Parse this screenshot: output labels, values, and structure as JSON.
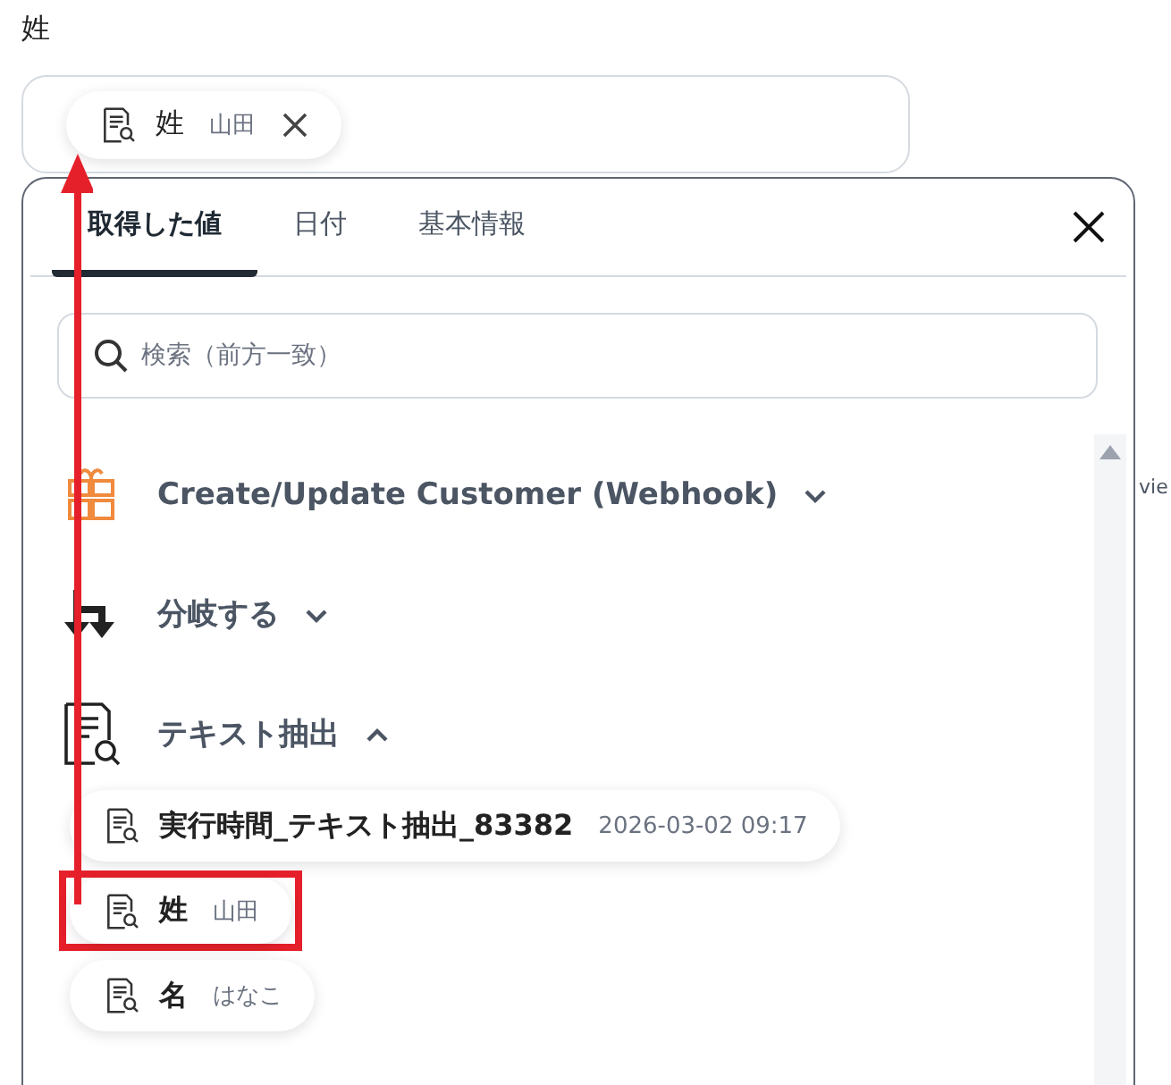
{
  "field": {
    "label": "姓",
    "chip": {
      "name": "姓",
      "value": "山田"
    }
  },
  "panel": {
    "tabs": [
      {
        "label": "取得した値",
        "selected": true
      },
      {
        "label": "日付",
        "selected": false
      },
      {
        "label": "基本情報",
        "selected": false
      }
    ],
    "search": {
      "placeholder": "検索（前方一致）"
    },
    "groups": [
      {
        "kind": "trigger",
        "title": "Create/Update Customer (Webhook)",
        "expanded": false
      },
      {
        "kind": "branch",
        "title": "分岐する",
        "expanded": false
      },
      {
        "kind": "extract",
        "title": "テキスト抽出",
        "expanded": true,
        "items": [
          {
            "name": "実行時間_テキスト抽出_83382",
            "value": "2026-03-02 09:17",
            "highlighted": false
          },
          {
            "name": "姓",
            "value": "山田",
            "highlighted": true
          },
          {
            "name": "名",
            "value": "はなこ",
            "highlighted": false
          }
        ]
      }
    ]
  },
  "side_text": "vie"
}
